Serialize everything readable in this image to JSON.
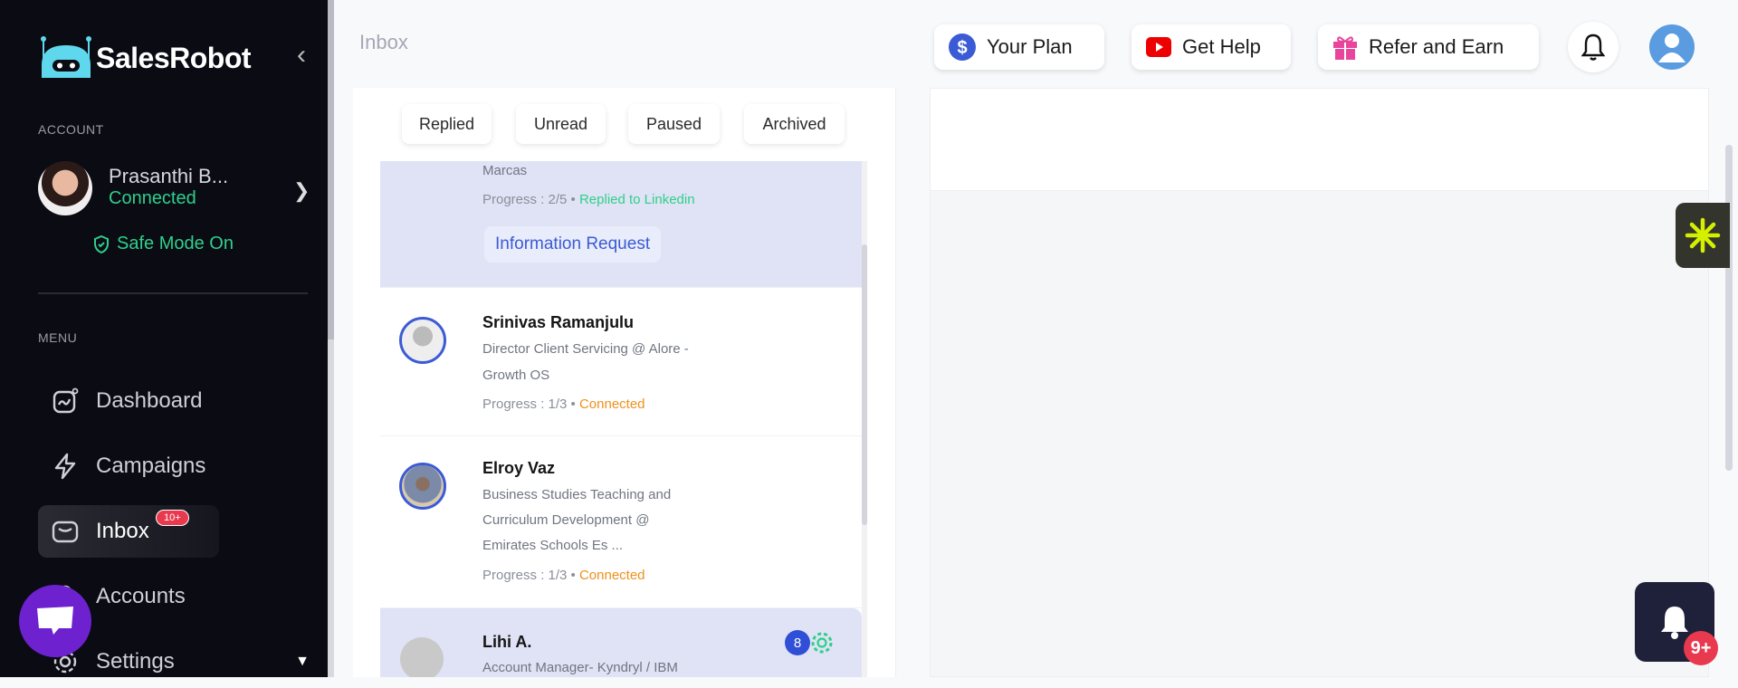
{
  "brand": {
    "name": "SalesRobot"
  },
  "account": {
    "section_label": "ACCOUNT",
    "name": "Prasanthi B...",
    "status": "Connected",
    "safe_mode": "Safe Mode On"
  },
  "menu": {
    "section_label": "MENU",
    "items": [
      {
        "label": "Dashboard"
      },
      {
        "label": "Campaigns"
      },
      {
        "label": "Inbox",
        "badge": "10+"
      },
      {
        "label": "Accounts"
      },
      {
        "label": "Settings"
      }
    ]
  },
  "header": {
    "title": "Inbox",
    "your_plan": "Your Plan",
    "get_help": "Get Help",
    "refer": "Refer and Earn"
  },
  "filters": [
    "Replied",
    "Unread",
    "Paused",
    "Archived"
  ],
  "leads": [
    {
      "lines": [
        "Marcas"
      ],
      "progress": "Progress : 2/5 •",
      "status": "Replied to Linkedin",
      "tag": "Information Request"
    },
    {
      "name": "Srinivas Ramanjulu",
      "lines": [
        "Director Client Servicing @ Alore -",
        "Growth OS"
      ],
      "progress": "Progress : 1/3 •",
      "status": "Connected"
    },
    {
      "name": "Elroy Vaz",
      "lines": [
        "Business Studies Teaching and",
        "Curriculum Development @",
        "Emirates Schools Es ..."
      ],
      "progress": "Progress : 1/3 •",
      "status": "Connected"
    },
    {
      "name": "Lihi A.",
      "lines": [
        "Account Manager- Kyndryl / IBM"
      ],
      "unread_count": "8"
    }
  ],
  "notifications": {
    "badge": "9+"
  },
  "colors": {
    "sidebar": "#0b0b14",
    "accent": "#3b5bd6",
    "success": "#2fcf8a",
    "warning": "#f0901c",
    "danger": "#e8394e"
  }
}
